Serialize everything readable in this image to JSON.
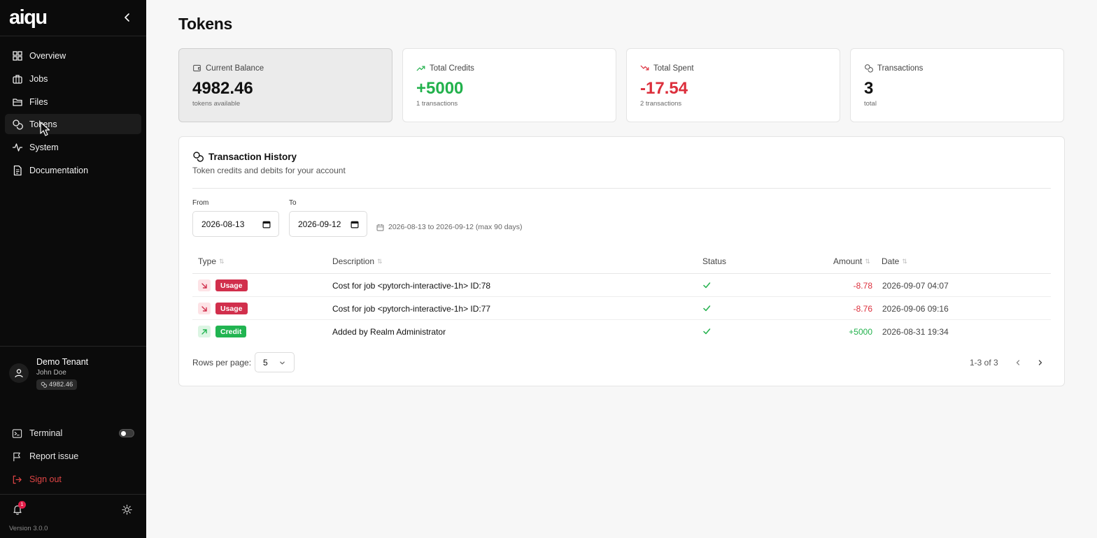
{
  "sidebar": {
    "brand": "aiqu",
    "nav": [
      {
        "label": "Overview",
        "icon": "grid-icon"
      },
      {
        "label": "Jobs",
        "icon": "briefcase-icon"
      },
      {
        "label": "Files",
        "icon": "folder-icon"
      },
      {
        "label": "Tokens",
        "icon": "coins-icon",
        "active": true
      },
      {
        "label": "System",
        "icon": "activity-icon"
      },
      {
        "label": "Documentation",
        "icon": "document-icon"
      }
    ],
    "tenant": {
      "name": "Demo Tenant",
      "user": "John Doe",
      "balance": "4982.46"
    },
    "terminal_label": "Terminal",
    "terminal_enabled": false,
    "report_label": "Report issue",
    "signout_label": "Sign out",
    "notification_count": "1",
    "version": "Version 3.0.0"
  },
  "page": {
    "title": "Tokens"
  },
  "cards": [
    {
      "label": "Current Balance",
      "value": "4982.46",
      "sub": "tokens available",
      "icon": "wallet-icon"
    },
    {
      "label": "Total Credits",
      "value": "+5000",
      "sub": "1 transactions",
      "icon": "trending-up-icon"
    },
    {
      "label": "Total Spent",
      "value": "-17.54",
      "sub": "2 transactions",
      "icon": "trending-down-icon"
    },
    {
      "label": "Transactions",
      "value": "3",
      "sub": "total",
      "icon": "coins-icon"
    }
  ],
  "history": {
    "title": "Transaction History",
    "subtitle": "Token credits and debits for your account",
    "from_label": "From",
    "from_value": "2026-08-13",
    "to_label": "To",
    "to_value": "2026-09-12",
    "range_note": "2026-08-13 to 2026-09-12 (max 90 days)",
    "columns": {
      "type": "Type",
      "description": "Description",
      "status": "Status",
      "amount": "Amount",
      "date": "Date"
    },
    "rows": [
      {
        "type": "Usage",
        "description": "Cost for job <pytorch-interactive-1h> ID:78",
        "status": "success",
        "amount": "-8.78",
        "date": "2026-09-07 04:07"
      },
      {
        "type": "Usage",
        "description": "Cost for job <pytorch-interactive-1h> ID:77",
        "status": "success",
        "amount": "-8.76",
        "date": "2026-09-06 09:16"
      },
      {
        "type": "Credit",
        "description": "Added by Realm Administrator",
        "status": "success",
        "amount": "+5000",
        "date": "2026-08-31 19:34"
      }
    ],
    "rows_per_page_label": "Rows per page:",
    "rows_per_page": "5",
    "page_count": "1-3 of 3"
  },
  "colors": {
    "positive": "#22b14c",
    "negative": "#dc2f3c",
    "usage_badge": "#d12f4c",
    "credit_badge": "#21b451",
    "sidebar_bg": "#0b0b0b"
  }
}
